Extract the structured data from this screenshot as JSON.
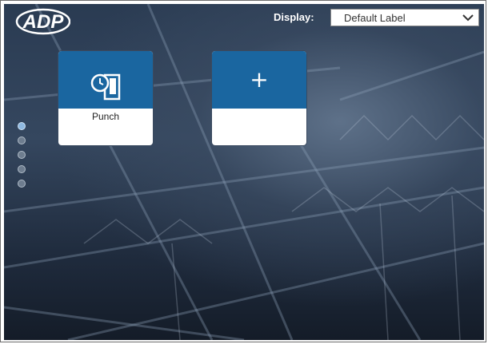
{
  "header": {
    "logo_text": "ADP",
    "display_label": "Display:",
    "display_select": {
      "selected": "Default Label"
    }
  },
  "tiles": [
    {
      "label": "Punch",
      "icon": "clock-door-icon"
    },
    {
      "label": "",
      "icon": "plus-icon",
      "symbol": "+"
    }
  ],
  "pagination": {
    "count": 5,
    "active_index": 0
  },
  "colors": {
    "tile_blue": "#1a66a0",
    "background": "#2a3b52",
    "dot_active": "#8fb9e0"
  }
}
